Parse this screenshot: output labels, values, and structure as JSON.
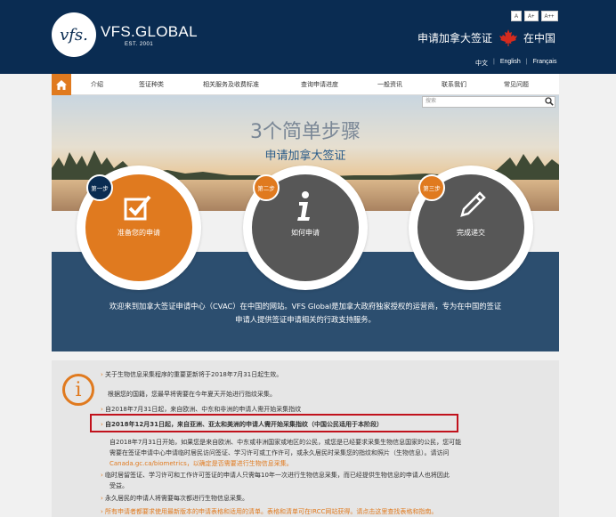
{
  "header": {
    "logo_mark": "vfs.",
    "logo_text": "VFS.GLOBAL",
    "logo_est": "EST. 2001",
    "title": "申请加拿大签证",
    "country": "在中国",
    "font_sizes": [
      "A",
      "A+",
      "A++"
    ],
    "languages": [
      "中文",
      "English",
      "Français"
    ],
    "colors": {
      "brand": "#0a2c52",
      "accent": "#e07a1f"
    }
  },
  "nav": {
    "home_icon": "home-icon",
    "items": [
      "介绍",
      "签证种类",
      "相关服务及收费标准",
      "查询申请进度",
      "一般资讯",
      "联系我们",
      "常见问题"
    ]
  },
  "search": {
    "placeholder": "搜索"
  },
  "hero": {
    "title": "3个简单步骤",
    "subtitle": "申请加拿大签证"
  },
  "steps": [
    {
      "badge": "第一步",
      "label": "准备您的申请",
      "icon": "checkbox-icon",
      "color": "#e07a1f"
    },
    {
      "badge": "第二步",
      "label": "如何申请",
      "icon": "info-icon",
      "color": "#575757"
    },
    {
      "badge": "第三步",
      "label": "完成递交",
      "icon": "pen-icon",
      "color": "#575757"
    }
  ],
  "welcome": {
    "line1": "欢迎来到加拿大签证申请中心（CVAC）在中国的网站。VFS Global是加拿大政府独家授权的运营商，专为在中国的签证",
    "line2": "申请人提供签证申请相关的行政支持服务。"
  },
  "notice": {
    "icon": "info-icon",
    "lines": [
      "关于生物信息采集程序的重要更新将于2018年7月31日起生效。",
      "根据您的国籍，您最早将需要在今年夏天开始进行指纹采集。",
      "自2018年7月31日起，来自欧洲、中东和非洲的申请人需开始采集指纹",
      "自2018年12月31日起，来自亚洲、亚太和美洲的申请人需开始采集指纹（中国公民适用于本阶段）",
      "自2018年7月31日开始，如果您是来自欧洲、中东或非洲国家或地区的公民，或您是已经要求采集生物信息国家的公民，您可能",
      "需要在签证申请中心申请临时居民访问签证、学习许可或工作许可，或永久居民时采集您的指纹和照片（生物信息）。请访问",
      "Canada.gc.ca/biometrics，以确定是否需要进行生物信息采集。",
      "临时居留签证、学习许可和工作许可签证的申请人只需每10年一次进行生物信息采集，而已经提供生物信息的申请人也将因此",
      "受益。",
      "永久居民的申请人将需要每次都进行生物信息采集。",
      "所有申请者都要求使用最新版本的申请表格和适用的清单。表格和清单可在IRCC网站获得。请点击这里查找表格和指南。"
    ]
  }
}
